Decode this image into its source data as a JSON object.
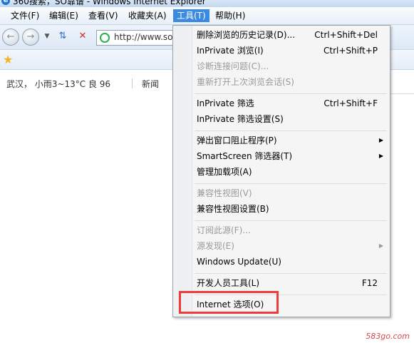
{
  "window": {
    "title": "360搜索，SO靠谱 - Windows Internet Explorer"
  },
  "menubar": {
    "items": [
      "文件(F)",
      "编辑(E)",
      "查看(V)",
      "收藏夹(A)",
      "工具(T)",
      "帮助(H)"
    ],
    "active": "工具(T)"
  },
  "navbar": {
    "address_value": "http://www.so"
  },
  "content": {
    "weather": "武汉， 小雨3~13°C  良 96",
    "news_link": "新闻"
  },
  "tools_menu": {
    "items": [
      {
        "label": "删除浏览的历史记录(D)...",
        "shortcut": "Ctrl+Shift+Del",
        "disabled": false
      },
      {
        "label": "InPrivate 浏览(I)",
        "shortcut": "Ctrl+Shift+P",
        "disabled": false
      },
      {
        "label": "诊断连接问题(C)...",
        "shortcut": "",
        "disabled": true
      },
      {
        "label": "重新打开上次浏览会话(S)",
        "shortcut": "",
        "disabled": true
      },
      {
        "label": "InPrivate 筛选",
        "shortcut": "Ctrl+Shift+F",
        "disabled": false
      },
      {
        "label": "InPrivate 筛选设置(S)",
        "shortcut": "",
        "disabled": false
      },
      {
        "label": "弹出窗口阻止程序(P)",
        "shortcut": "",
        "disabled": false,
        "submenu": true
      },
      {
        "label": "SmartScreen 筛选器(T)",
        "shortcut": "",
        "disabled": false,
        "submenu": true
      },
      {
        "label": "管理加载项(A)",
        "shortcut": "",
        "disabled": false
      },
      {
        "label": "兼容性视图(V)",
        "shortcut": "",
        "disabled": true
      },
      {
        "label": "兼容性视图设置(B)",
        "shortcut": "",
        "disabled": false
      },
      {
        "label": "订阅此源(F)...",
        "shortcut": "",
        "disabled": true
      },
      {
        "label": "源发现(E)",
        "shortcut": "",
        "disabled": true,
        "submenu": true
      },
      {
        "label": "Windows Update(U)",
        "shortcut": "",
        "disabled": false
      },
      {
        "label": "开发人员工具(L)",
        "shortcut": "F12",
        "disabled": false
      },
      {
        "label": "Internet 选项(O)",
        "shortcut": "",
        "disabled": false
      }
    ]
  },
  "highlight_color": "#ef3b3b",
  "watermark": "583go.com"
}
